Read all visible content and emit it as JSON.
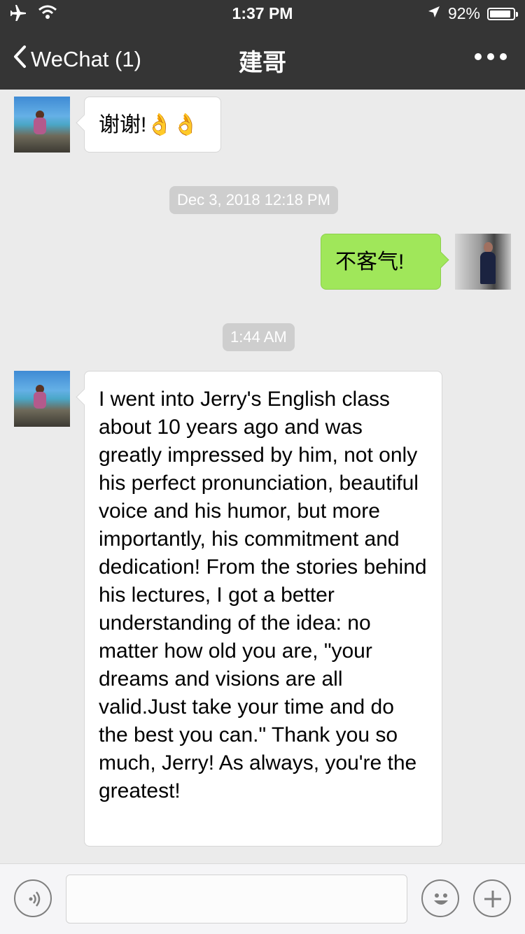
{
  "status_bar": {
    "time": "1:37 PM",
    "battery_percent": "92%",
    "battery_level": 0.92
  },
  "nav": {
    "back_label": "WeChat (1)",
    "title": "建哥"
  },
  "messages": [
    {
      "side": "left",
      "text": "谢谢!👌👌"
    },
    {
      "timestamp": "Dec 3, 2018 12:18 PM"
    },
    {
      "side": "right",
      "text": "不客气!"
    },
    {
      "timestamp": "1:44 AM"
    },
    {
      "side": "left",
      "text": "I went into Jerry's English class about 10 years ago and was greatly impressed by him, not only his perfect pronunciation, beautiful voice and his humor, but more importantly, his commitment and dedication! From the stories behind his lectures, I got a better understanding of the idea: no matter how old you are, \"your dreams and visions are all valid.Just take your time and do the best you can.\" Thank you so much, Jerry! As always, you're the greatest!"
    }
  ],
  "icons": {
    "back": "chevron-left-icon",
    "more": "more-dots-icon",
    "voice": "voice-icon",
    "emoji": "emoji-icon",
    "add": "plus-icon"
  },
  "colors": {
    "header_bg": "#353535",
    "chat_bg": "#ebebeb",
    "sent_bubble": "#a0e75a",
    "received_bubble": "#ffffff"
  }
}
